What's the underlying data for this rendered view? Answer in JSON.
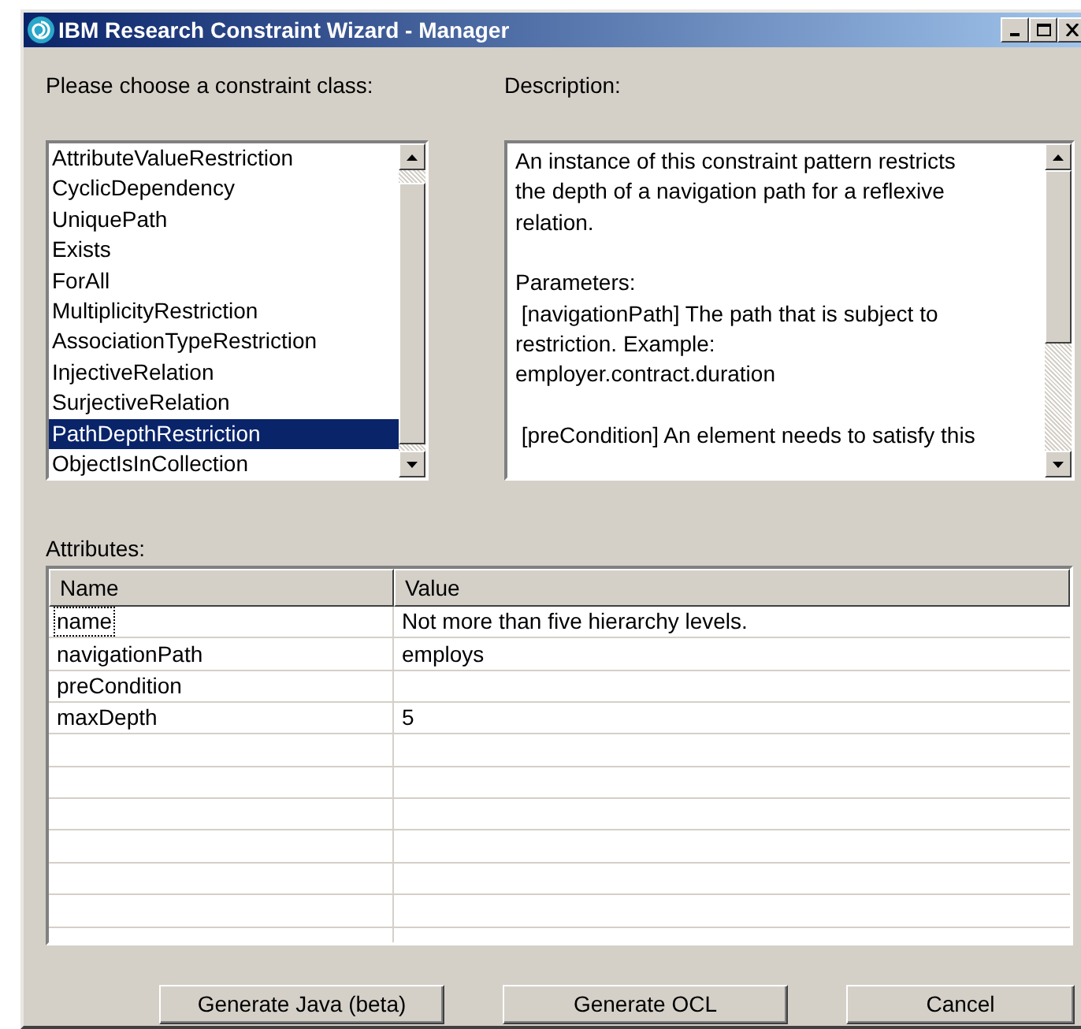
{
  "window": {
    "title": "IBM Research Constraint Wizard - Manager"
  },
  "class_list": {
    "label": "Please choose a constraint class:",
    "items": [
      {
        "label": "AttributeValueRestriction",
        "selected": false
      },
      {
        "label": "CyclicDependency",
        "selected": false
      },
      {
        "label": "UniquePath",
        "selected": false
      },
      {
        "label": "Exists",
        "selected": false
      },
      {
        "label": "ForAll",
        "selected": false
      },
      {
        "label": "MultiplicityRestriction",
        "selected": false
      },
      {
        "label": "AssociationTypeRestriction",
        "selected": false
      },
      {
        "label": "InjectiveRelation",
        "selected": false
      },
      {
        "label": "SurjectiveRelation",
        "selected": false
      },
      {
        "label": "PathDepthRestriction",
        "selected": true
      },
      {
        "label": "ObjectIsInCollection",
        "selected": false
      }
    ]
  },
  "description": {
    "label": "Description:",
    "paragraphs": [
      [
        "An instance of this constraint pattern restricts",
        "the depth of a navigation path for a reflexive",
        "relation."
      ],
      [
        "Parameters:",
        " [navigationPath] The path that is subject to",
        "restriction. Example:",
        "employer.contract.duration"
      ],
      [
        " [preCondition] An element needs to satisfy this"
      ]
    ]
  },
  "attributes": {
    "label": "Attributes:",
    "columns": [
      "Name",
      "Value"
    ],
    "rows": [
      {
        "name": "name",
        "value": "Not more than five hierarchy levels.",
        "focused": true
      },
      {
        "name": "navigationPath",
        "value": "employs",
        "focused": false
      },
      {
        "name": "preCondition",
        "value": "",
        "focused": false
      },
      {
        "name": "maxDepth",
        "value": "5",
        "focused": false
      }
    ]
  },
  "buttons": [
    "Generate Java (beta)",
    "Generate OCL",
    "Cancel"
  ]
}
